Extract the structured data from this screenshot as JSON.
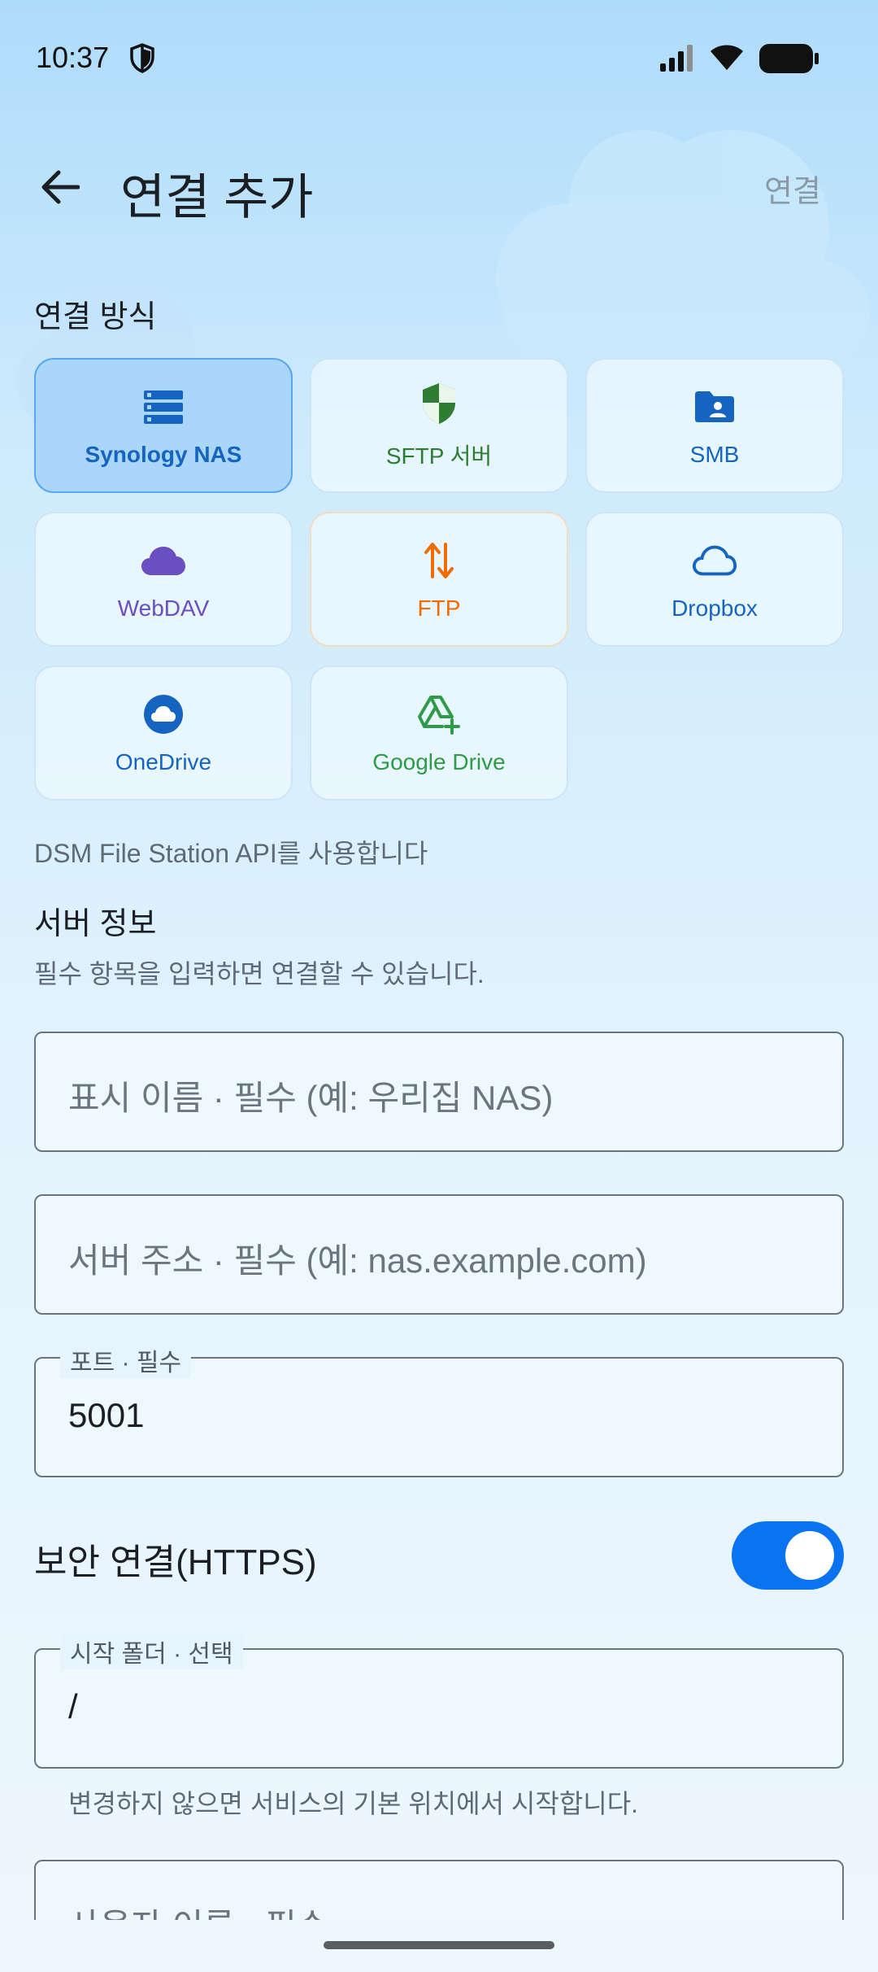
{
  "status_bar": {
    "time": "10:37"
  },
  "app_bar": {
    "title": "연결 추가",
    "action_label": "연결"
  },
  "connection_methods": {
    "section_label": "연결 방식",
    "items": [
      {
        "label": "Synology NAS",
        "icon": "server-stack-icon",
        "color": "#1565c0",
        "selected": true
      },
      {
        "label": "SFTP 서버",
        "icon": "shield-icon",
        "color": "#2e7d32",
        "selected": false
      },
      {
        "label": "SMB",
        "icon": "shared-folder-icon",
        "color": "#1565c0",
        "selected": false
      },
      {
        "label": "WebDAV",
        "icon": "cloud-filled-icon",
        "color": "#6a4fc0",
        "selected": false
      },
      {
        "label": "FTP",
        "icon": "transfer-arrows-icon",
        "color": "#ef6c00",
        "selected": false
      },
      {
        "label": "Dropbox",
        "icon": "cloud-outline-icon",
        "color": "#1565c0",
        "selected": false
      },
      {
        "label": "OneDrive",
        "icon": "cloud-circle-icon",
        "color": "#1565c0",
        "selected": false
      },
      {
        "label": "Google Drive",
        "icon": "drive-add-icon",
        "color": "#2e9b48",
        "selected": false
      }
    ],
    "description": "DSM File Station API를 사용합니다"
  },
  "server_info": {
    "section_label": "서버 정보",
    "subtitle": "필수 항목을 입력하면 연결할 수 있습니다.",
    "display_name_placeholder": "표시 이름 · 필수 (예: 우리집 NAS)",
    "server_address_placeholder": "서버 주소 · 필수 (예: nas.example.com)",
    "port_label": "포트 · 필수",
    "port_value": "5001",
    "https_label": "보안 연결(HTTPS)",
    "https_enabled": true,
    "start_folder_label": "시작 폴더 · 선택",
    "start_folder_value": "/",
    "start_folder_helper": "변경하지 않으면 서비스의 기본 위치에서 시작합니다.",
    "username_placeholder": "사용자 이름 · 필수"
  },
  "colors": {
    "accent": "#0a74f0",
    "selected_card": "#a9d6fa"
  }
}
